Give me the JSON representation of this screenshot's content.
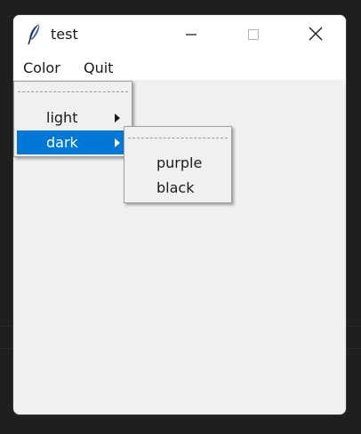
{
  "window": {
    "title": "test",
    "icon": "feather-icon"
  },
  "caption_buttons": {
    "minimize_icon": "minimize-icon",
    "maximize_icon": "maximize-icon",
    "close_icon": "close-icon"
  },
  "menubar": {
    "items": [
      {
        "label": "Color"
      },
      {
        "label": "Quit"
      }
    ]
  },
  "color_menu": {
    "items": [
      {
        "label": "light",
        "has_submenu": true,
        "active": false
      },
      {
        "label": "dark",
        "has_submenu": true,
        "active": true
      }
    ]
  },
  "dark_submenu": {
    "items": [
      {
        "label": "purple"
      },
      {
        "label": "black"
      }
    ]
  },
  "colors": {
    "highlight": "#0078d7",
    "window_bg": "#f0f0f0",
    "titlebar_bg": "#ffffff",
    "desktop_bg": "#1f1f1f"
  }
}
